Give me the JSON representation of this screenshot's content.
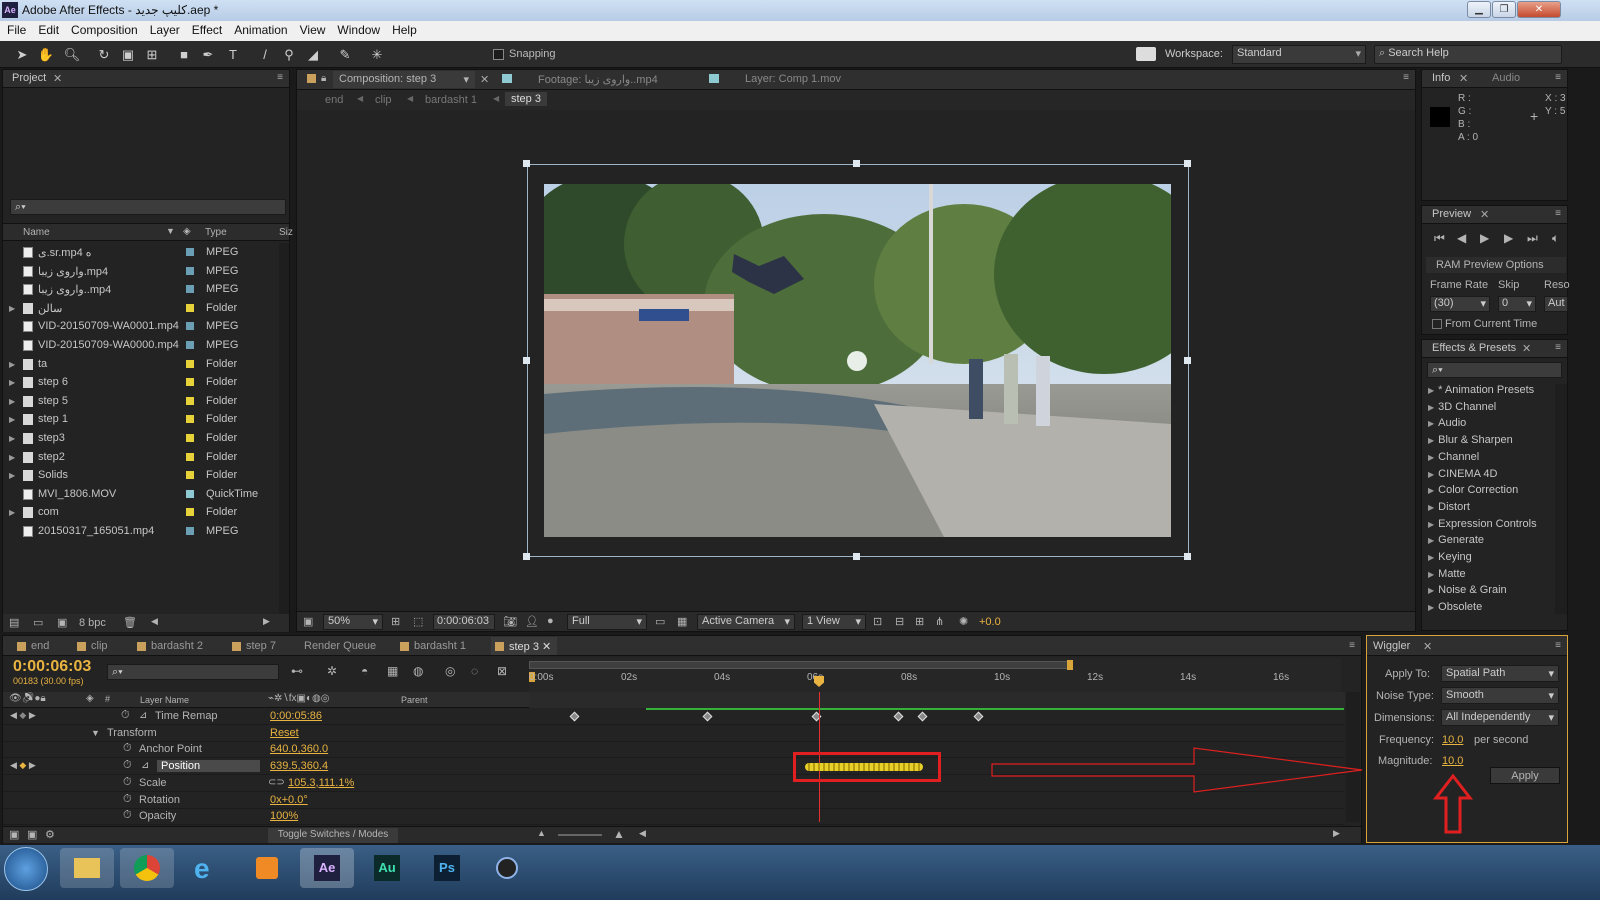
{
  "titlebar": {
    "title": "Adobe After Effects - کلیپ جدید.aep *",
    "app_icon": "Ae",
    "min": "▁",
    "max": "❐",
    "close": "✕"
  },
  "menu": [
    "File",
    "Edit",
    "Composition",
    "Layer",
    "Effect",
    "Animation",
    "View",
    "Window",
    "Help"
  ],
  "toolbar": {
    "snapping": "Snapping",
    "workspace_label": "Workspace:",
    "workspace_value": "Standard",
    "search_placeholder": "Search Help"
  },
  "project": {
    "tab": "Project",
    "cols": {
      "name": "Name",
      "type": "Type",
      "size": "Siz"
    },
    "items": [
      {
        "name": "ی.sr.mp4 ه",
        "type": "MPEG",
        "kind": "file",
        "color": "#6a9fb5"
      },
      {
        "name": "واروی زیبا.mp4",
        "type": "MPEG",
        "kind": "file",
        "color": "#6a9fb5"
      },
      {
        "name": "واروی زیبا..mp4",
        "type": "MPEG",
        "kind": "file",
        "color": "#6a9fb5"
      },
      {
        "name": "سالن",
        "type": "Folder",
        "kind": "folder",
        "color": "#e8d23a"
      },
      {
        "name": "VID-20150709-WA0001.mp4",
        "type": "MPEG",
        "kind": "file",
        "color": "#6a9fb5"
      },
      {
        "name": "VID-20150709-WA0000.mp4",
        "type": "MPEG",
        "kind": "file",
        "color": "#6a9fb5"
      },
      {
        "name": "ta",
        "type": "Folder",
        "kind": "folder",
        "color": "#e8d23a"
      },
      {
        "name": "step 6",
        "type": "Folder",
        "kind": "folder",
        "color": "#e8d23a"
      },
      {
        "name": "step 5",
        "type": "Folder",
        "kind": "folder",
        "color": "#e8d23a"
      },
      {
        "name": "step 1",
        "type": "Folder",
        "kind": "folder",
        "color": "#e8d23a"
      },
      {
        "name": "step3",
        "type": "Folder",
        "kind": "folder",
        "color": "#e8d23a"
      },
      {
        "name": "step2",
        "type": "Folder",
        "kind": "folder",
        "color": "#e8d23a"
      },
      {
        "name": "Solids",
        "type": "Folder",
        "kind": "folder",
        "color": "#e8d23a"
      },
      {
        "name": "MVI_1806.MOV",
        "type": "QuickTime",
        "kind": "file",
        "color": "#8fc9d1"
      },
      {
        "name": "com",
        "type": "Folder",
        "kind": "folder",
        "color": "#e8d23a"
      },
      {
        "name": "20150317_165051.mp4",
        "type": "MPEG",
        "kind": "file",
        "color": "#6a9fb5"
      }
    ],
    "bpc": "8 bpc"
  },
  "viewer": {
    "tabs": [
      "Composition: step 3",
      "Footage: واروی زیبا..mp4",
      "Layer: Comp 1.mov"
    ],
    "breadcrumbs": [
      "end",
      "clip",
      "bardasht 1",
      "step 3"
    ],
    "zoom": "50%",
    "timecode": "0:00:06:03",
    "resolution": "Full",
    "camera": "Active Camera",
    "views": "1 View",
    "exposure": "+0.0"
  },
  "info": {
    "tabs": [
      "Info",
      "Audio"
    ],
    "r": "R :",
    "g": "G :",
    "b": "B :",
    "a": "A : 0",
    "x": "X : 3",
    "y": "Y : 5"
  },
  "preview": {
    "tab": "Preview",
    "ram": "RAM Preview Options",
    "frame_rate_label": "Frame Rate",
    "skip_label": "Skip",
    "res_label": "Reso",
    "frame_rate": "(30)",
    "skip": "0",
    "res": "Aut",
    "from_current": "From Current Time"
  },
  "effects": {
    "tab": "Effects & Presets",
    "items": [
      "* Animation Presets",
      "3D Channel",
      "Audio",
      "Blur & Sharpen",
      "Channel",
      "CINEMA 4D",
      "Color Correction",
      "Distort",
      "Expression Controls",
      "Generate",
      "Keying",
      "Matte",
      "Noise & Grain",
      "Obsolete"
    ]
  },
  "timeline": {
    "tabs": [
      "end",
      "clip",
      "bardasht 2",
      "step 7",
      "Render Queue",
      "bardasht 1",
      "step 3"
    ],
    "timecode": "0:00:06:03",
    "frames": "00183 (30.00 fps)",
    "ruler": [
      "0:00s",
      "02s",
      "04s",
      "06s",
      "08s",
      "10s",
      "12s",
      "14s",
      "16s"
    ],
    "col_layer": "Layer Name",
    "col_parent": "Parent",
    "props": [
      {
        "name": "Time Remap",
        "value": "0:00:05:86"
      },
      {
        "name": "Transform",
        "value": "Reset"
      },
      {
        "name": "Anchor Point",
        "value": "640.0,360.0"
      },
      {
        "name": "Position",
        "value": "639.5,360.4"
      },
      {
        "name": "Scale",
        "value": "105.3,111.1%"
      },
      {
        "name": "Rotation",
        "value": "0x+0.0°"
      },
      {
        "name": "Opacity",
        "value": "100%"
      }
    ],
    "toggle": "Toggle Switches / Modes"
  },
  "wiggler": {
    "tab": "Wiggler",
    "apply_to_label": "Apply To:",
    "apply_to": "Spatial Path",
    "noise_label": "Noise Type:",
    "noise": "Smooth",
    "dims_label": "Dimensions:",
    "dims": "All Independently",
    "freq_label": "Frequency:",
    "freq": "10.0",
    "per_second": "per second",
    "mag_label": "Magnitude:",
    "mag": "10.0",
    "apply": "Apply"
  },
  "taskbar": {
    "apps": [
      "explorer",
      "chrome",
      "ie",
      "media",
      "Ae",
      "Au",
      "Ps",
      "cinema4d"
    ]
  }
}
